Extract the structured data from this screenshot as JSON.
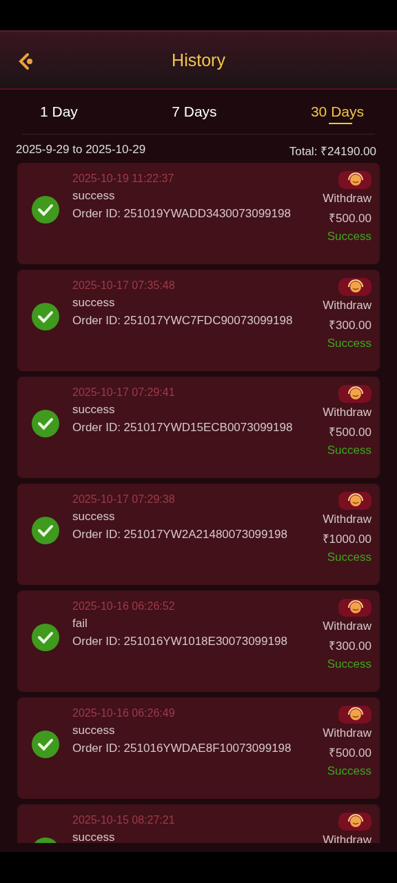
{
  "header": {
    "title": "History"
  },
  "tabs": [
    {
      "label": "1 Day",
      "selected": false
    },
    {
      "label": "7 Days",
      "selected": false
    },
    {
      "label": "30 Days",
      "selected": true
    }
  ],
  "summary": {
    "range": "2025-9-29 to 2025-10-29",
    "total": "Total: ₹24190.00"
  },
  "records": [
    {
      "time": "2025-10-19 11:22:37",
      "note": "success",
      "order": "Order ID: 251019YWADD3430073099198",
      "type": "Withdraw",
      "amount": "₹500.00",
      "status": "Success"
    },
    {
      "time": "2025-10-17 07:35:48",
      "note": "success",
      "order": "Order ID: 251017YWC7FDC90073099198",
      "type": "Withdraw",
      "amount": "₹300.00",
      "status": "Success"
    },
    {
      "time": "2025-10-17 07:29:41",
      "note": "success",
      "order": "Order ID: 251017YWD15ECB0073099198",
      "type": "Withdraw",
      "amount": "₹500.00",
      "status": "Success"
    },
    {
      "time": "2025-10-17 07:29:38",
      "note": "success",
      "order": "Order ID: 251017YW2A21480073099198",
      "type": "Withdraw",
      "amount": "₹1000.00",
      "status": "Success"
    },
    {
      "time": "2025-10-16 06:26:52",
      "note": "fail",
      "order": "Order ID: 251016YW1018E30073099198",
      "type": "Withdraw",
      "amount": "₹300.00",
      "status": "Success"
    },
    {
      "time": "2025-10-16 06:26:49",
      "note": "success",
      "order": "Order ID: 251016YWDAE8F10073099198",
      "type": "Withdraw",
      "amount": "₹500.00",
      "status": "Success"
    },
    {
      "time": "2025-10-15 08:27:21",
      "note": "success",
      "type": "Withdraw"
    }
  ]
}
